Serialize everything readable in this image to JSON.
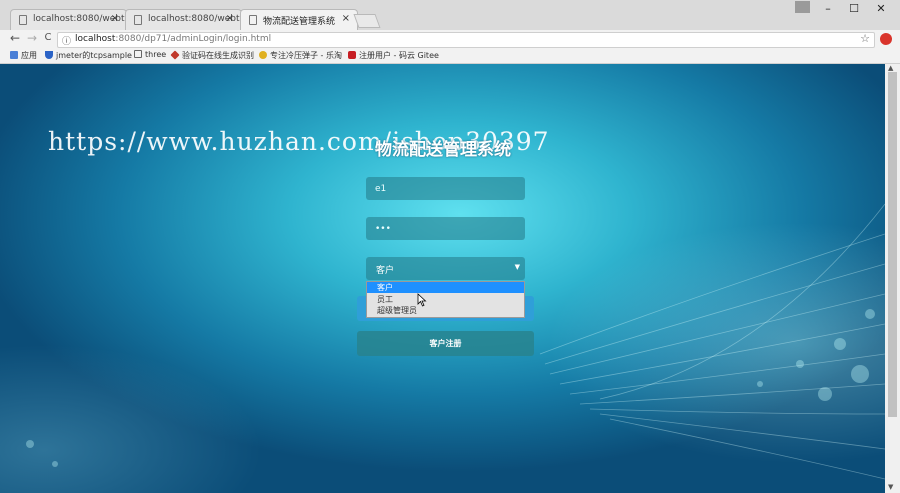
{
  "browser": {
    "tabs": [
      {
        "label": "localhost:8080/webtoo",
        "close": "×"
      },
      {
        "label": "localhost:8080/webtoo",
        "close": "×"
      },
      {
        "label": "物流配送管理系统",
        "close": "×"
      }
    ],
    "window_controls": {
      "minimize": "–",
      "maximize": "☐",
      "close": "✕"
    },
    "nav": {
      "back": "←",
      "forward": "→",
      "reload": "C"
    },
    "address": {
      "info": "ⓘ",
      "host": "localhost",
      "path": ":8080/dp71/adminLogin/login.html",
      "star": "☆"
    },
    "bookmarks": [
      {
        "label": "应用",
        "icon": "apps-icon",
        "color": "#4a7fd6"
      },
      {
        "label": "jmeter的tcpsample",
        "icon": "shield-icon",
        "color": "#2b63c6"
      },
      {
        "label": "three",
        "icon": "page-icon",
        "color": "#ffffff"
      },
      {
        "label": "验证码在线生成识别",
        "icon": "gem-icon",
        "color": "#c0392b"
      },
      {
        "label": "专注冷压弹子 - 乐淘",
        "icon": "hand-icon",
        "color": "#e0b020"
      },
      {
        "label": "注册用户 - 码云 Gitee",
        "icon": "gitee-icon",
        "color": "#c71d23"
      }
    ]
  },
  "watermark": "https://www.huzhan.com/ishop30397",
  "login": {
    "title": "物流配送管理系统",
    "username_value": "e1",
    "password_value": "•••",
    "role_selected": "客户",
    "role_options": [
      "客户",
      "员工",
      "超级管理员"
    ],
    "login_button_label": "",
    "register_button_label": "客户注册"
  },
  "colors": {
    "accent": "#2f9fd8",
    "option_highlight": "#1e90ff",
    "page_background": "#2fb4cf"
  }
}
